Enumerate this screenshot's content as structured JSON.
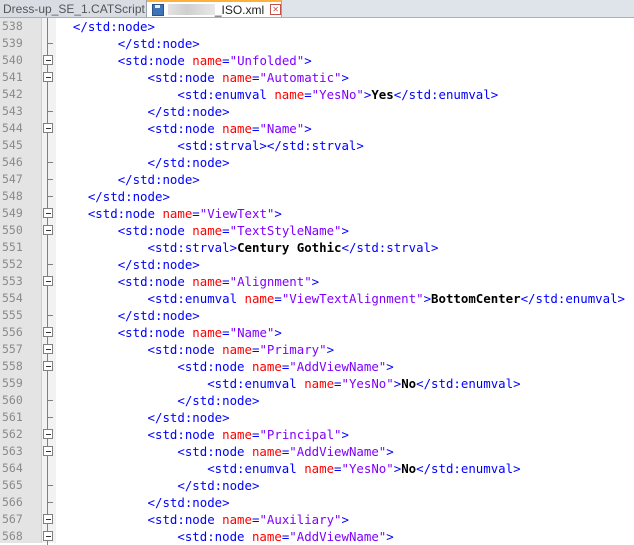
{
  "tabs": [
    {
      "label": "Dress-up_SE_1.CATScript",
      "active": false
    },
    {
      "label": "_ISO.xml",
      "active": true
    }
  ],
  "icons": {
    "tab_close": "close-box-icon",
    "save_state": "floppy-disk-icon",
    "fold_open": "fold-minus-icon"
  },
  "colors": {
    "tag": "#0000ff",
    "attr": "#ff0000",
    "value": "#8000ff",
    "text": "#000000",
    "active_tab_accent": "#ffaf3c"
  },
  "lines": [
    {
      "n": "538",
      "indent": 1,
      "fold": "line",
      "parts": [
        [
          "t",
          "</std:node>"
        ]
      ]
    },
    {
      "n": "539",
      "indent": 4,
      "fold": "end",
      "parts": [
        [
          "t",
          "</std:node>"
        ]
      ]
    },
    {
      "n": "540",
      "indent": 4,
      "fold": "open",
      "parts": [
        [
          "t",
          "<std:node "
        ],
        [
          "a",
          "name"
        ],
        [
          "t",
          "="
        ],
        [
          "v",
          "\"Unfolded\""
        ],
        [
          "t",
          ">"
        ]
      ]
    },
    {
      "n": "541",
      "indent": 6,
      "fold": "open",
      "parts": [
        [
          "t",
          "<std:node "
        ],
        [
          "a",
          "name"
        ],
        [
          "t",
          "="
        ],
        [
          "v",
          "\"Automatic\""
        ],
        [
          "t",
          ">"
        ]
      ]
    },
    {
      "n": "542",
      "indent": 8,
      "fold": "line",
      "parts": [
        [
          "t",
          "<std:enumval "
        ],
        [
          "a",
          "name"
        ],
        [
          "t",
          "="
        ],
        [
          "v",
          "\"YesNo\""
        ],
        [
          "t",
          ">"
        ],
        [
          "x",
          "Yes"
        ],
        [
          "t",
          "</std:enumval>"
        ]
      ]
    },
    {
      "n": "543",
      "indent": 6,
      "fold": "end",
      "parts": [
        [
          "t",
          "</std:node>"
        ]
      ]
    },
    {
      "n": "544",
      "indent": 6,
      "fold": "open",
      "parts": [
        [
          "t",
          "<std:node "
        ],
        [
          "a",
          "name"
        ],
        [
          "t",
          "="
        ],
        [
          "v",
          "\"Name\""
        ],
        [
          "t",
          ">"
        ]
      ]
    },
    {
      "n": "545",
      "indent": 8,
      "fold": "line",
      "parts": [
        [
          "t",
          "<std:strval></std:strval>"
        ]
      ]
    },
    {
      "n": "546",
      "indent": 6,
      "fold": "end",
      "parts": [
        [
          "t",
          "</std:node>"
        ]
      ]
    },
    {
      "n": "547",
      "indent": 4,
      "fold": "end",
      "parts": [
        [
          "t",
          "</std:node>"
        ]
      ]
    },
    {
      "n": "548",
      "indent": 2,
      "fold": "end",
      "parts": [
        [
          "t",
          "</std:node>"
        ]
      ]
    },
    {
      "n": "549",
      "indent": 2,
      "fold": "open",
      "parts": [
        [
          "t",
          "<std:node "
        ],
        [
          "a",
          "name"
        ],
        [
          "t",
          "="
        ],
        [
          "v",
          "\"ViewText\""
        ],
        [
          "t",
          ">"
        ]
      ]
    },
    {
      "n": "550",
      "indent": 4,
      "fold": "open",
      "parts": [
        [
          "t",
          "<std:node "
        ],
        [
          "a",
          "name"
        ],
        [
          "t",
          "="
        ],
        [
          "v",
          "\"TextStyleName\""
        ],
        [
          "t",
          ">"
        ]
      ]
    },
    {
      "n": "551",
      "indent": 6,
      "fold": "line",
      "parts": [
        [
          "t",
          "<std:strval>"
        ],
        [
          "x",
          "Century Gothic"
        ],
        [
          "t",
          "</std:strval>"
        ]
      ]
    },
    {
      "n": "552",
      "indent": 4,
      "fold": "end",
      "parts": [
        [
          "t",
          "</std:node>"
        ]
      ]
    },
    {
      "n": "553",
      "indent": 4,
      "fold": "open",
      "parts": [
        [
          "t",
          "<std:node "
        ],
        [
          "a",
          "name"
        ],
        [
          "t",
          "="
        ],
        [
          "v",
          "\"Alignment\""
        ],
        [
          "t",
          ">"
        ]
      ]
    },
    {
      "n": "554",
      "indent": 6,
      "fold": "line",
      "parts": [
        [
          "t",
          "<std:enumval "
        ],
        [
          "a",
          "name"
        ],
        [
          "t",
          "="
        ],
        [
          "v",
          "\"ViewTextAlignment\""
        ],
        [
          "t",
          ">"
        ],
        [
          "x",
          "BottomCenter"
        ],
        [
          "t",
          "</std:enumval>"
        ]
      ]
    },
    {
      "n": "555",
      "indent": 4,
      "fold": "end",
      "parts": [
        [
          "t",
          "</std:node>"
        ]
      ]
    },
    {
      "n": "556",
      "indent": 4,
      "fold": "open",
      "parts": [
        [
          "t",
          "<std:node "
        ],
        [
          "a",
          "name"
        ],
        [
          "t",
          "="
        ],
        [
          "v",
          "\"Name\""
        ],
        [
          "t",
          ">"
        ]
      ]
    },
    {
      "n": "557",
      "indent": 6,
      "fold": "open",
      "parts": [
        [
          "t",
          "<std:node "
        ],
        [
          "a",
          "name"
        ],
        [
          "t",
          "="
        ],
        [
          "v",
          "\"Primary\""
        ],
        [
          "t",
          ">"
        ]
      ]
    },
    {
      "n": "558",
      "indent": 8,
      "fold": "open",
      "parts": [
        [
          "t",
          "<std:node "
        ],
        [
          "a",
          "name"
        ],
        [
          "t",
          "="
        ],
        [
          "v",
          "\"AddViewName\""
        ],
        [
          "t",
          ">"
        ]
      ]
    },
    {
      "n": "559",
      "indent": 10,
      "fold": "line",
      "parts": [
        [
          "t",
          "<std:enumval "
        ],
        [
          "a",
          "name"
        ],
        [
          "t",
          "="
        ],
        [
          "v",
          "\"YesNo\""
        ],
        [
          "t",
          ">"
        ],
        [
          "x",
          "No"
        ],
        [
          "t",
          "</std:enumval>"
        ]
      ]
    },
    {
      "n": "560",
      "indent": 8,
      "fold": "end",
      "parts": [
        [
          "t",
          "</std:node>"
        ]
      ]
    },
    {
      "n": "561",
      "indent": 6,
      "fold": "end",
      "parts": [
        [
          "t",
          "</std:node>"
        ]
      ]
    },
    {
      "n": "562",
      "indent": 6,
      "fold": "open",
      "parts": [
        [
          "t",
          "<std:node "
        ],
        [
          "a",
          "name"
        ],
        [
          "t",
          "="
        ],
        [
          "v",
          "\"Principal\""
        ],
        [
          "t",
          ">"
        ]
      ]
    },
    {
      "n": "563",
      "indent": 8,
      "fold": "open",
      "parts": [
        [
          "t",
          "<std:node "
        ],
        [
          "a",
          "name"
        ],
        [
          "t",
          "="
        ],
        [
          "v",
          "\"AddViewName\""
        ],
        [
          "t",
          ">"
        ]
      ]
    },
    {
      "n": "564",
      "indent": 10,
      "fold": "line",
      "parts": [
        [
          "t",
          "<std:enumval "
        ],
        [
          "a",
          "name"
        ],
        [
          "t",
          "="
        ],
        [
          "v",
          "\"YesNo\""
        ],
        [
          "t",
          ">"
        ],
        [
          "x",
          "No"
        ],
        [
          "t",
          "</std:enumval>"
        ]
      ]
    },
    {
      "n": "565",
      "indent": 8,
      "fold": "end",
      "parts": [
        [
          "t",
          "</std:node>"
        ]
      ]
    },
    {
      "n": "566",
      "indent": 6,
      "fold": "end",
      "parts": [
        [
          "t",
          "</std:node>"
        ]
      ]
    },
    {
      "n": "567",
      "indent": 6,
      "fold": "open",
      "parts": [
        [
          "t",
          "<std:node "
        ],
        [
          "a",
          "name"
        ],
        [
          "t",
          "="
        ],
        [
          "v",
          "\"Auxiliary\""
        ],
        [
          "t",
          ">"
        ]
      ]
    },
    {
      "n": "568",
      "indent": 8,
      "fold": "open",
      "parts": [
        [
          "t",
          "<std:node "
        ],
        [
          "a",
          "name"
        ],
        [
          "t",
          "="
        ],
        [
          "v",
          "\"AddViewName\""
        ],
        [
          "t",
          ">"
        ]
      ]
    }
  ]
}
